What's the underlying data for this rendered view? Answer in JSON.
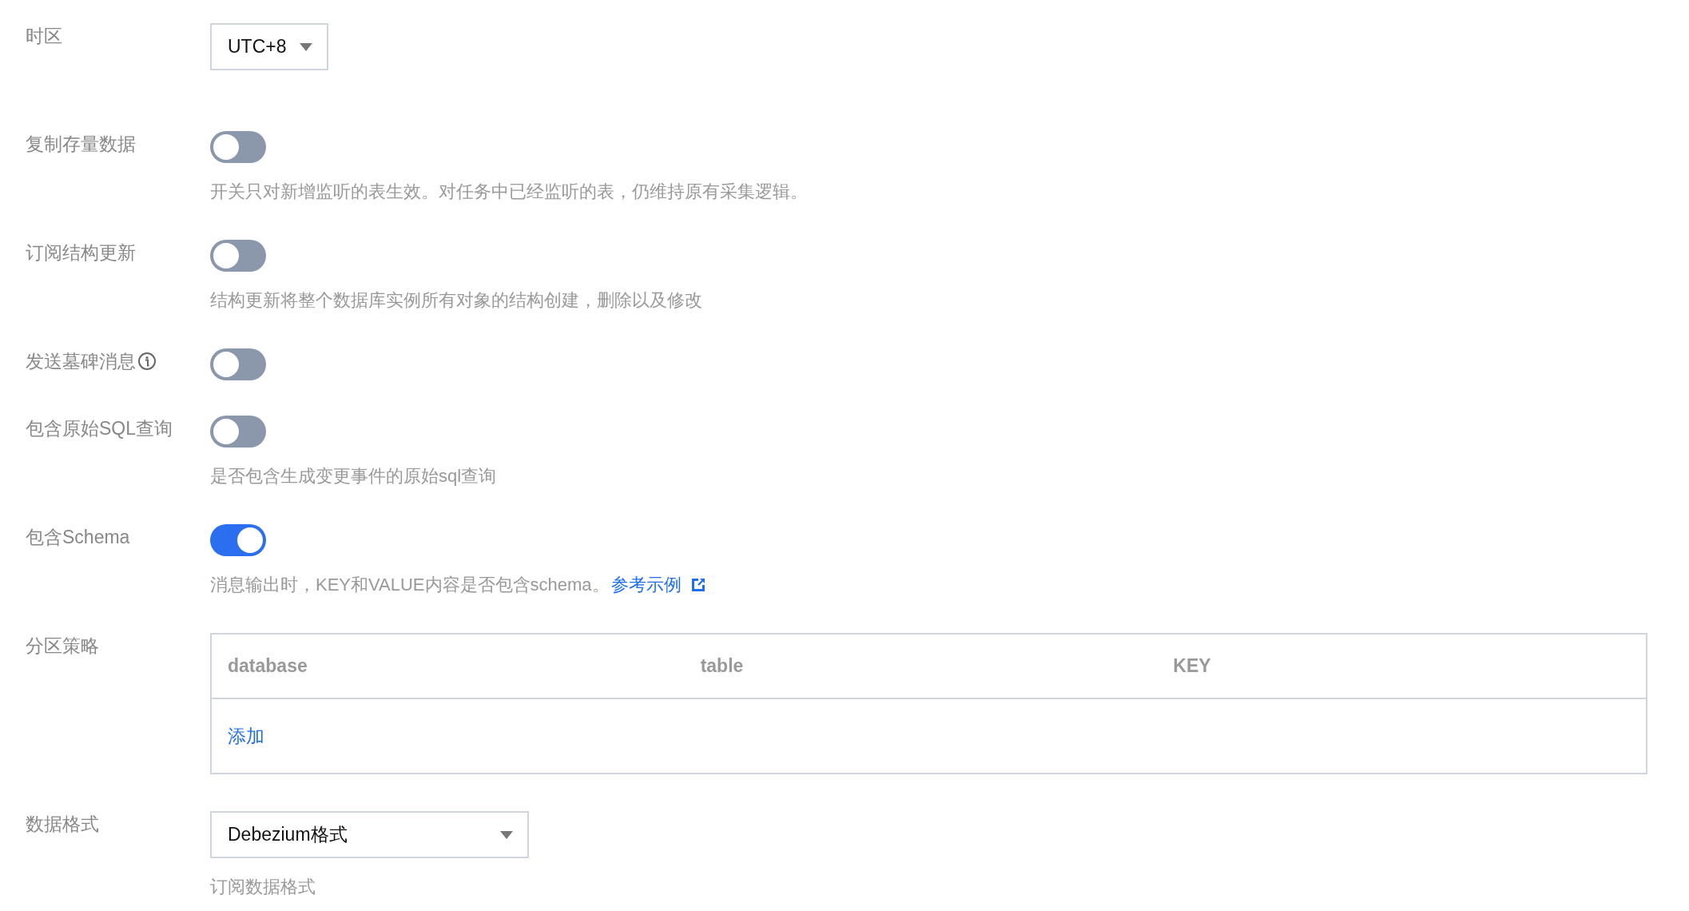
{
  "fields": [
    {
      "kind": "select",
      "label": "时区",
      "value": "UTC+8"
    },
    {
      "kind": "switch",
      "label": "复制存量数据",
      "on": false,
      "help": "开关只对新增监听的表生效。对任务中已经监听的表，仍维持原有采集逻辑。"
    },
    {
      "kind": "switch",
      "label": "订阅结构更新",
      "on": false,
      "help": "结构更新将整个数据库实例所有对象的结构创建，删除以及修改"
    },
    {
      "kind": "switch",
      "label": "发送墓碑消息",
      "info": true,
      "on": false
    },
    {
      "kind": "switch",
      "label": "包含原始SQL查询",
      "on": false,
      "help": "是否包含生成变更事件的原始sql查询"
    },
    {
      "kind": "switch",
      "label": "包含Schema",
      "on": true,
      "help": "消息输出时，KEY和VALUE内容是否包含schema。",
      "link": "参考示例"
    },
    {
      "kind": "table",
      "label": "分区策略",
      "columns": [
        "database",
        "table",
        "KEY"
      ],
      "add_link": "添加"
    },
    {
      "kind": "select",
      "label": "数据格式",
      "value": "Debezium格式",
      "help": "订阅数据格式"
    }
  ]
}
